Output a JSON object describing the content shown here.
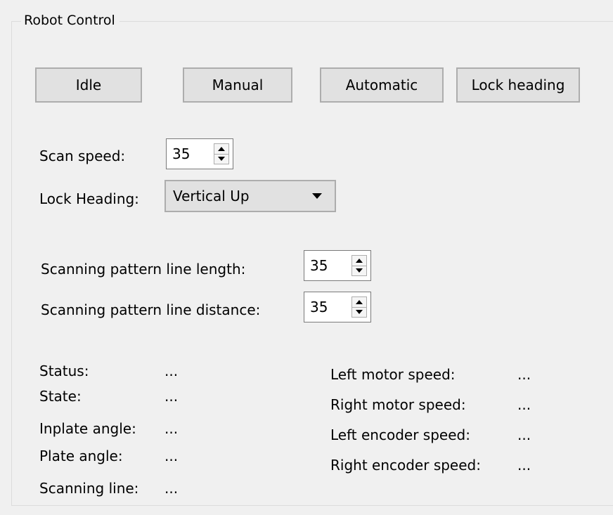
{
  "group": {
    "title": "Robot Control"
  },
  "buttons": {
    "idle": "Idle",
    "manual": "Manual",
    "automatic": "Automatic",
    "lock_heading": "Lock heading"
  },
  "scan_speed": {
    "label": "Scan speed:",
    "value": "35"
  },
  "lock_heading": {
    "label": "Lock Heading:",
    "selected": "Vertical Up"
  },
  "line_length": {
    "label": "Scanning pattern line length:",
    "value": "35"
  },
  "line_distance": {
    "label": "Scanning pattern line distance:",
    "value": "35"
  },
  "status_left": [
    {
      "label": "Status:",
      "value": "..."
    },
    {
      "label": "State:",
      "value": "..."
    },
    {
      "label": "Inplate angle:",
      "value": "..."
    },
    {
      "label": "Plate angle:",
      "value": "..."
    },
    {
      "label": "Scanning line:",
      "value": "..."
    }
  ],
  "status_right": [
    {
      "label": "Left motor speed:",
      "value": "..."
    },
    {
      "label": "Right motor speed:",
      "value": "..."
    },
    {
      "label": "Left encoder speed:",
      "value": "..."
    },
    {
      "label": "Right encoder speed:",
      "value": "..."
    }
  ]
}
